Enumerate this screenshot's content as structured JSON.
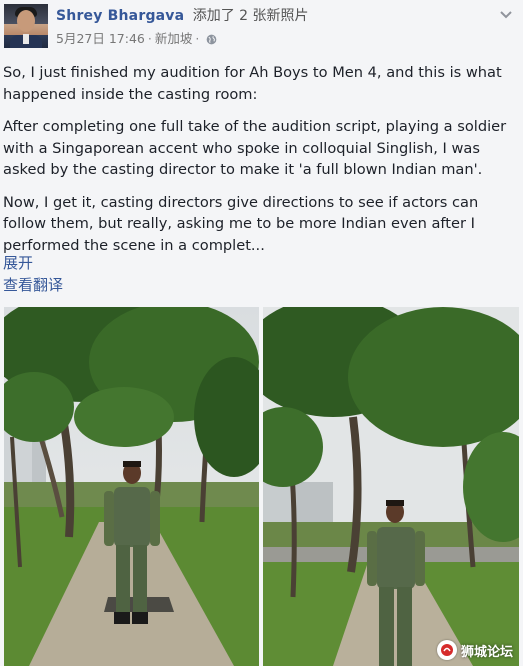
{
  "post": {
    "author": "Shrey Bhargava",
    "action": "添加了 2 张新照片",
    "date": "5月27日 17:46",
    "separator": "·",
    "location": "新加坡",
    "globe_icon": "globe-icon",
    "menu_icon": "chevron-down-icon",
    "paragraphs": [
      "So, I just finished my audition for Ah Boys to Men 4, and this is what happened inside the casting room:",
      "After completing one full take of the audition script, playing a soldier with a Singaporean accent who spoke in colloquial Singlish, I was asked by the casting director to make it 'a full blown Indian man'.",
      "Now, I get it, casting directors give directions to see if actors can follow them, but really, asking me to be more Indian even after I performed the scene in a complet..."
    ],
    "see_more": "展开",
    "translate": "查看翻译"
  },
  "watermark": {
    "text": "狮城论坛"
  },
  "colors": {
    "link": "#365899",
    "text": "#1d2129",
    "meta": "#777777",
    "uniform": "#5a6e45"
  }
}
